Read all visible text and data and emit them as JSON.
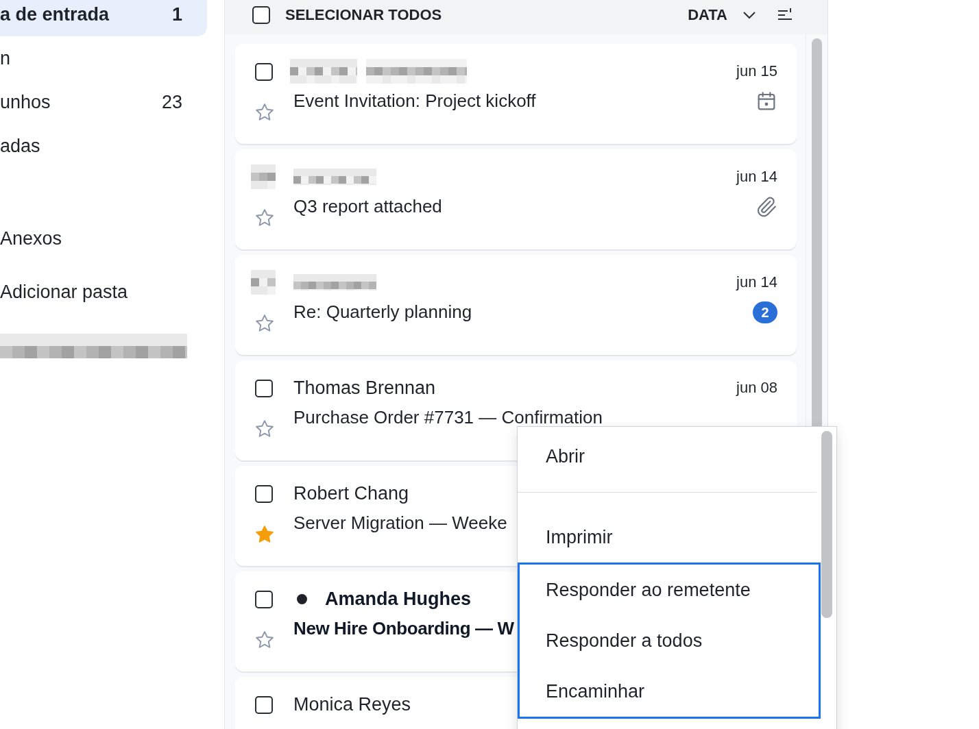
{
  "sidebar": {
    "folders": [
      {
        "label": "a de entrada",
        "count": "1",
        "selected": true
      },
      {
        "label": "n",
        "selected": false
      },
      {
        "label": "unhos",
        "count": "23",
        "selected": false
      },
      {
        "label": "adas",
        "selected": false
      }
    ],
    "tools": [
      {
        "label": "Anexos"
      },
      {
        "label": "Adicionar pasta"
      }
    ]
  },
  "list_header": {
    "select_all": {
      "label": "SELECIONAR TODOS",
      "checked": false
    },
    "sort": {
      "label": "DATA"
    }
  },
  "messages": [
    {
      "kind": "checkbox",
      "checked": false,
      "sender_redacted": true,
      "subject": "Event Invitation: Project kickoff",
      "date": "jun 15",
      "indicator": {
        "kind": "calendar"
      },
      "starred": false,
      "unread": false
    },
    {
      "kind": "avatar",
      "sender_redacted": true,
      "subject": "Q3 report attached",
      "date": "jun 14",
      "indicator": {
        "kind": "attachment"
      },
      "starred": false,
      "unread": false
    },
    {
      "kind": "avatar",
      "sender_redacted": true,
      "subject": "Re: Quarterly planning",
      "date": "jun 14",
      "indicator": {
        "kind": "count",
        "text": "2"
      },
      "starred": false,
      "unread": false
    },
    {
      "kind": "checkbox",
      "checked": false,
      "sender_redacted": false,
      "sender": "Thomas Brennan",
      "subject": "Purchase Order #7731 — Confirmation",
      "date": "jun 08",
      "starred": false,
      "unread": false
    },
    {
      "kind": "checkbox",
      "checked": false,
      "sender_redacted": false,
      "sender": "Robert Chang",
      "subject": "Server Migration — Weeke",
      "starred": true,
      "unread": false
    },
    {
      "kind": "checkbox",
      "checked": false,
      "sender_redacted": false,
      "sender": "Amanda Hughes",
      "subject": "New Hire Onboarding — W",
      "starred": false,
      "unread": true
    },
    {
      "kind": "checkbox",
      "checked": false,
      "sender_redacted": false,
      "sender": "Monica Reyes",
      "unread": false
    }
  ],
  "context_menu": {
    "items": [
      {
        "label": "Abrir",
        "highlighted": false,
        "divider_after": true
      },
      {
        "label": "Imprimir",
        "highlighted": false,
        "divider_after": false
      },
      {
        "label": "Responder ao remetente",
        "highlighted": true,
        "divider_after": false
      },
      {
        "label": "Responder a todos",
        "highlighted": true,
        "divider_after": false
      },
      {
        "label": "Encaminhar",
        "highlighted": true,
        "divider_after": false
      }
    ]
  }
}
